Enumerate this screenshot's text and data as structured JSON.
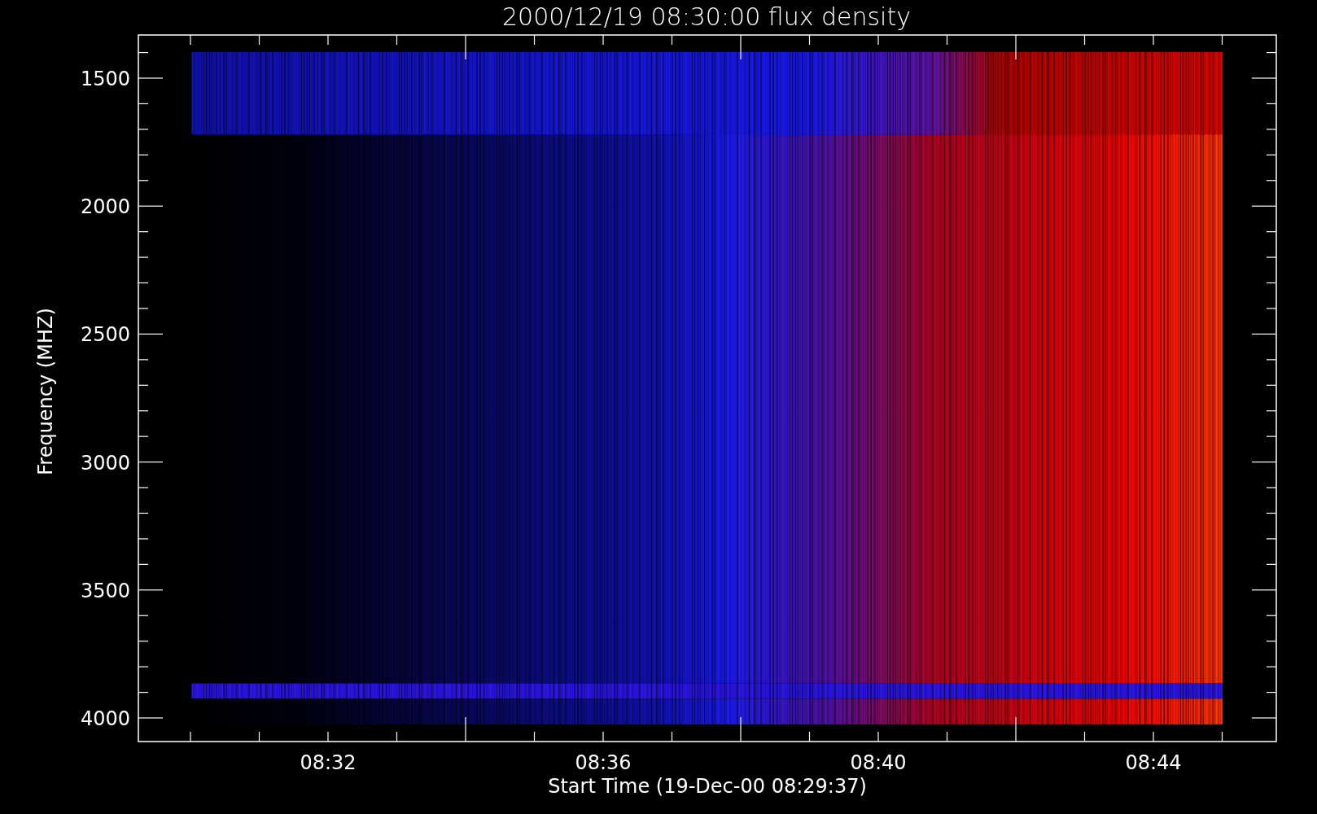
{
  "plot": {
    "title": "2000/12/19 08:30:00 flux density",
    "ylabel": "Frequency (MHZ)",
    "xlabel": "Start Time (19-Dec-00 08:29:37)",
    "yticks": [
      "1500",
      "2000",
      "2500",
      "3000",
      "3500",
      "4000"
    ],
    "xticks": [
      "08:32",
      "08:36",
      "08:40",
      "08:44"
    ]
  }
}
